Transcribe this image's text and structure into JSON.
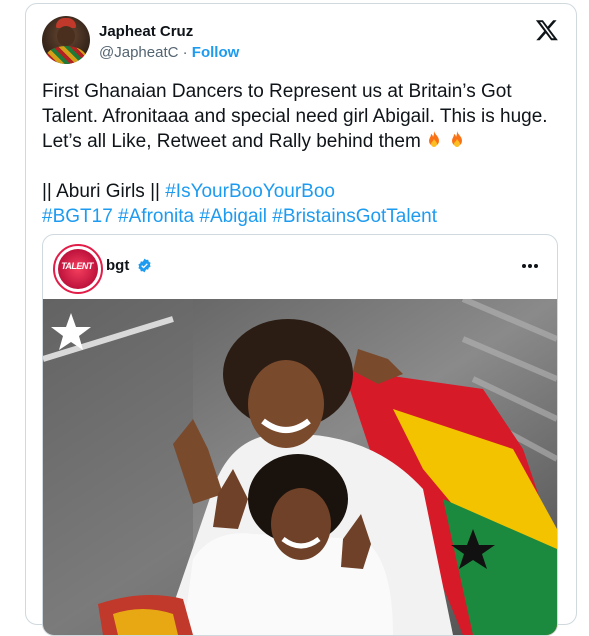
{
  "author": {
    "name": "Japheat Cruz",
    "handle": "@JapheatC",
    "separator": "·",
    "follow_label": "Follow"
  },
  "tweet": {
    "line1": "First Ghanaian Dancers to Represent us at Britain’s Got Talent. Afronitaaa and special need girl Abigail. This is huge. Let’s all Like, Retweet and Rally behind them",
    "line2_prefix": "|| Aburi Girls ||",
    "hashtags_line2": [
      "#IsYourBooYourBoo"
    ],
    "hashtags_line3": [
      "#BGT17",
      "#Afronita",
      "#Abigail",
      "#BristainsGotTalent"
    ]
  },
  "quoted": {
    "name": "bgt",
    "avatar_text": "TALENT",
    "more_icon": "ellipsis-icon"
  },
  "colors": {
    "accent": "#1d9bf0",
    "text": "#0f1419",
    "muted": "#536471",
    "border": "#cfd9de"
  },
  "icons": [
    "x-logo-icon",
    "fire-icon",
    "verified-badge-icon",
    "ellipsis-icon",
    "star-icon"
  ]
}
